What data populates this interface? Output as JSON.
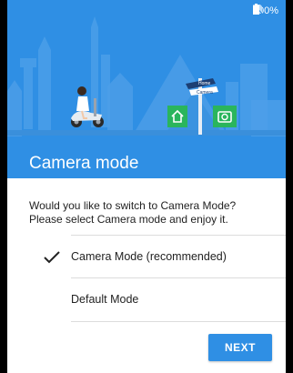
{
  "status_bar": {
    "battery_percent": "100%",
    "icons": [
      "no-sim-icon",
      "battery-icon"
    ]
  },
  "hero": {
    "title": "Camera mode",
    "signpost": {
      "sign_top": "Home",
      "sign_bottom": "Camera"
    },
    "icons": [
      "home-icon",
      "camera-icon"
    ],
    "background_color": "#2f8fe4"
  },
  "description": {
    "line1": "Would you like to switch to Camera Mode?",
    "line2": "Please select Camera mode and enjoy it."
  },
  "options": [
    {
      "label": "Camera Mode (recommended)",
      "selected": true
    },
    {
      "label": "Default Mode",
      "selected": false
    }
  ],
  "actions": {
    "next_label": "NEXT"
  },
  "colors": {
    "accent": "#2f8fe4",
    "icon_green": "#2ab55c"
  }
}
